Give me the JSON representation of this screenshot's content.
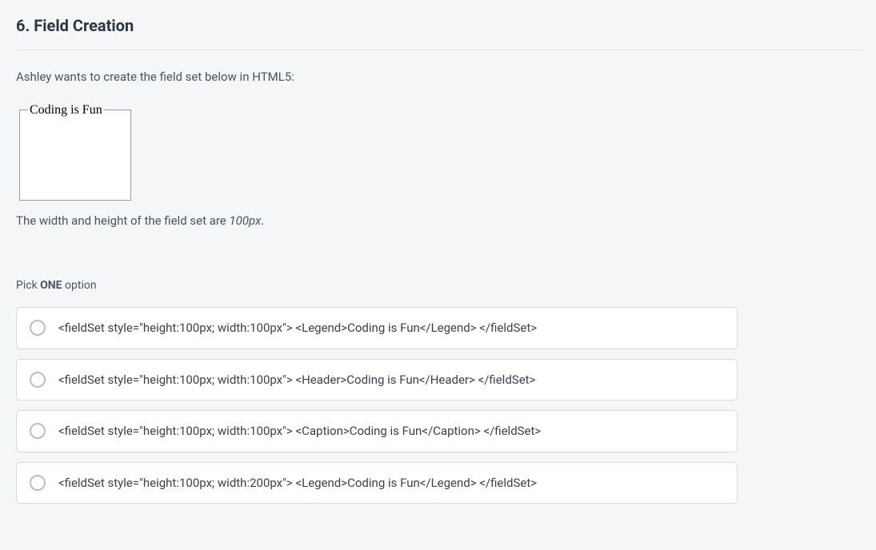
{
  "question": {
    "number": "6",
    "title": "Field Creation",
    "intro": "Ashley wants to create the field set below in HTML5:",
    "fieldset_legend": "Coding is Fun",
    "dimension_prefix": "The width and height of the field set are ",
    "dimension_value": "100px",
    "dimension_suffix": ".",
    "pick_prefix": "Pick ",
    "pick_bold": "ONE",
    "pick_suffix": " option"
  },
  "options": [
    {
      "text": "<fieldSet style=\"height:100px; width:100px\"> <Legend>Coding is Fun</Legend> </fieldSet>"
    },
    {
      "text": "<fieldSet style=\"height:100px; width:100px\"> <Header>Coding is Fun</Header> </fieldSet>"
    },
    {
      "text": "<fieldSet style=\"height:100px; width:100px\"> <Caption>Coding is Fun</Caption> </fieldSet>"
    },
    {
      "text": "<fieldSet style=\"height:100px; width:200px\"> <Legend>Coding is Fun</Legend> </fieldSet>"
    }
  ]
}
